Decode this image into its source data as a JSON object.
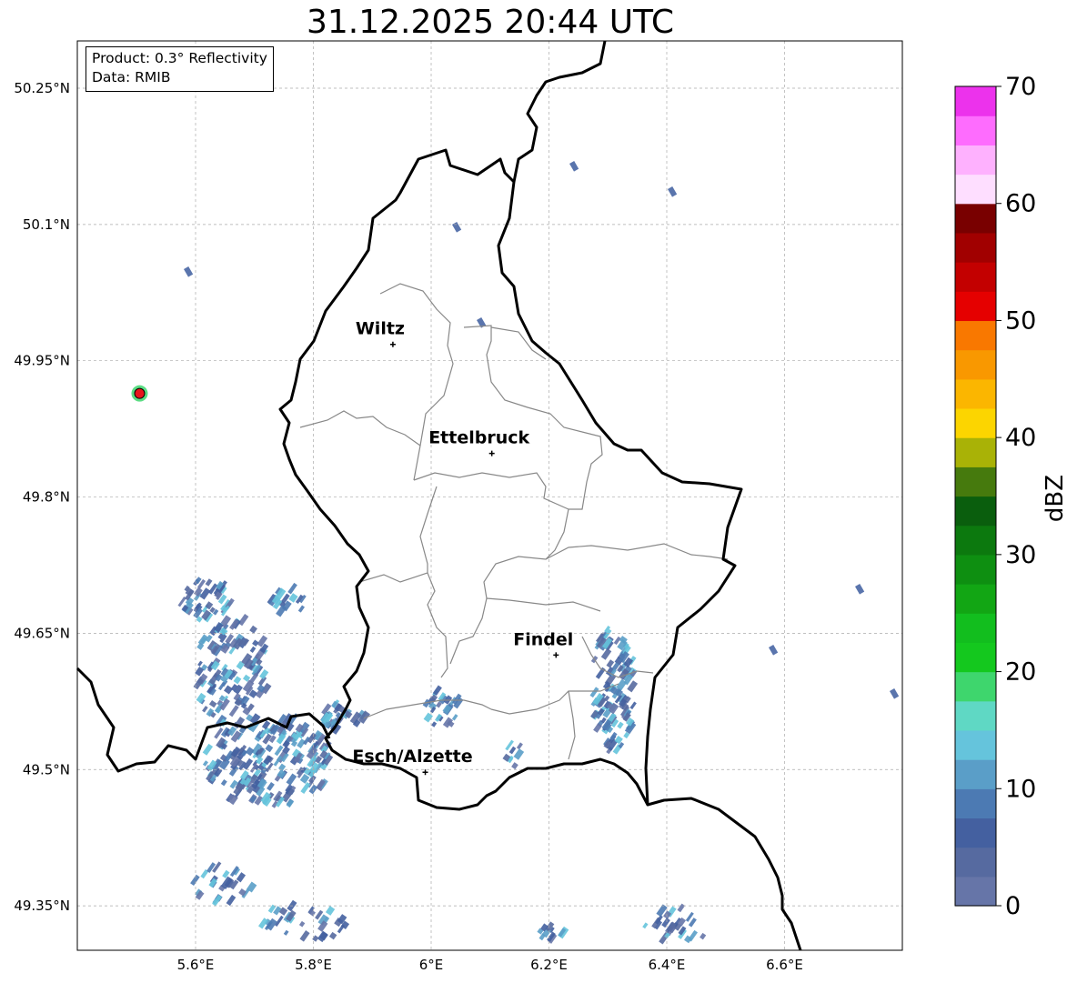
{
  "title": "31.12.2025 20:44 UTC",
  "info": {
    "product": "Product: 0.3° Reflectivity",
    "data_source": "Data: RMIB"
  },
  "map": {
    "lon_ticks": [
      {
        "value": 5.6,
        "label": "5.6°E"
      },
      {
        "value": 5.8,
        "label": "5.8°E"
      },
      {
        "value": 6.0,
        "label": "6°E"
      },
      {
        "value": 6.2,
        "label": "6.2°E"
      },
      {
        "value": 6.4,
        "label": "6.4°E"
      },
      {
        "value": 6.6,
        "label": "6.6°E"
      }
    ],
    "lat_ticks": [
      {
        "value": 50.25,
        "label": "50.25°N"
      },
      {
        "value": 50.1,
        "label": "50.1°N"
      },
      {
        "value": 49.95,
        "label": "49.95°N"
      },
      {
        "value": 49.8,
        "label": "49.8°N"
      },
      {
        "value": 49.65,
        "label": "49.65°N"
      },
      {
        "value": 49.5,
        "label": "49.5°N"
      },
      {
        "value": 49.35,
        "label": "49.35°N"
      }
    ],
    "extent": {
      "lon_min": 5.4,
      "lon_max": 6.8,
      "lat_min": 49.3,
      "lat_max": 50.3
    },
    "gridlines": true,
    "cities": [
      {
        "name": "Wiltz",
        "lon": 5.935,
        "lat": 49.968
      },
      {
        "name": "Ettelbruck",
        "lon": 6.103,
        "lat": 49.848
      },
      {
        "name": "Findel",
        "lon": 6.212,
        "lat": 49.626
      },
      {
        "name": "Esch/Alzette",
        "lon": 5.99,
        "lat": 49.497
      }
    ],
    "radar_site": {
      "lon": 5.505,
      "lat": 49.914,
      "color": "#e8141c"
    }
  },
  "colorbar": {
    "label": "dBZ",
    "ticks": [
      "0",
      "10",
      "20",
      "30",
      "40",
      "50",
      "60",
      "70"
    ],
    "levels": [
      0,
      70
    ],
    "colors": [
      "#6675a8",
      "#566aa0",
      "#4460a0",
      "#4c7ab3",
      "#5a9ec8",
      "#65c4dc",
      "#5fd8c4",
      "#3ed66d",
      "#14c81e",
      "#12be1e",
      "#12a614",
      "#0e8f11",
      "#0c790e",
      "#0a5e0d",
      "#467a0d",
      "#a9b206",
      "#fcd500",
      "#fbb600",
      "#f99800",
      "#f97800",
      "#e50000",
      "#c30000",
      "#a10000",
      "#790000",
      "#fedeff",
      "#feb1fe",
      "#fe6cfe",
      "#ec32ec"
    ]
  }
}
